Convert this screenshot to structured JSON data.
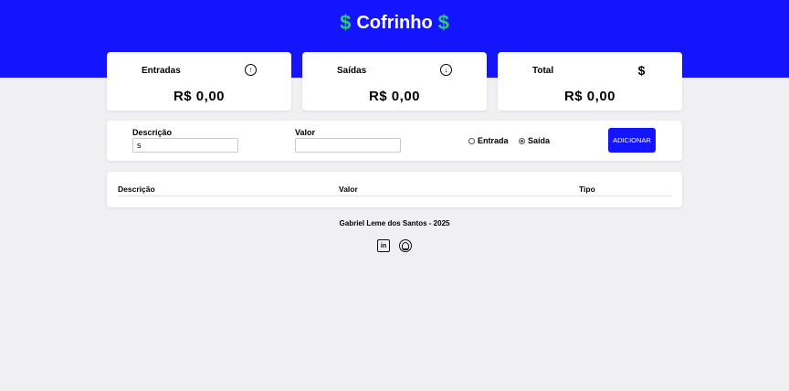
{
  "brand": {
    "title": "Cofrinho",
    "icon": "dollar-icon",
    "accent": "#2ecc71",
    "primary": "#1414ff"
  },
  "cards": [
    {
      "title": "Entradas",
      "icon": "arrow-up-circle-icon",
      "value": "R$ 0,00"
    },
    {
      "title": "Saídas",
      "icon": "arrow-down-circle-icon",
      "value": "R$ 0,00"
    },
    {
      "title": "Total",
      "icon": "dollar-icon",
      "value": "R$ 0,00"
    }
  ],
  "form": {
    "description_label": "Descrição",
    "description_value": "s",
    "value_label": "Valor",
    "value_value": "",
    "type_options": [
      {
        "label": "Entrada",
        "checked": false
      },
      {
        "label": "Saída",
        "checked": true
      }
    ],
    "add_button": "ADICIONAR"
  },
  "table": {
    "headers": [
      "Descrição",
      "Valor",
      "Tipo"
    ],
    "rows": []
  },
  "footer": {
    "credit": "Gabriel Leme dos Santos - 2025",
    "social": [
      {
        "icon": "linkedin-icon"
      },
      {
        "icon": "github-icon"
      }
    ]
  }
}
